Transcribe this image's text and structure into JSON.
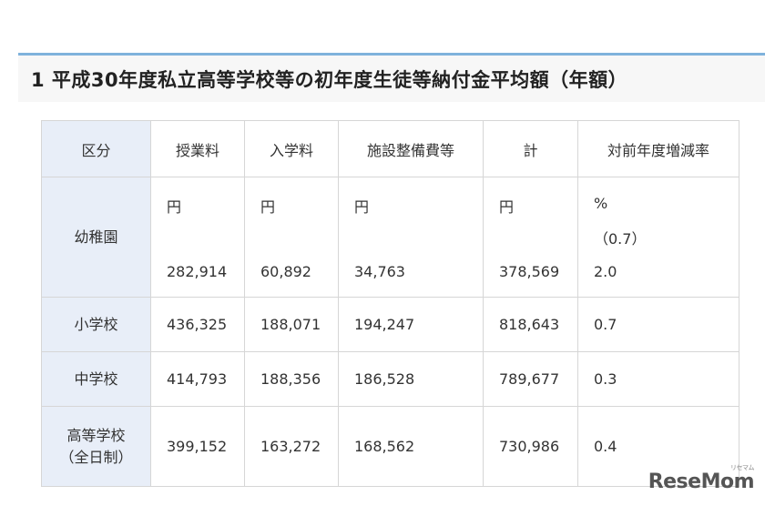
{
  "heading": "1 平成30年度私立高等学校等の初年度生徒等納付金平均額（年額）",
  "table": {
    "headers": [
      "区分",
      "授業料",
      "入学料",
      "施設整備費等",
      "計",
      "対前年度増減率"
    ],
    "kindergarten": {
      "label": "幼稚園",
      "unit_yen": "円",
      "unit_pct": "%",
      "prev_rate": "（0.7）",
      "tuition": "282,914",
      "admission": "60,892",
      "facility": "34,763",
      "total": "378,569",
      "rate": "2.0"
    },
    "elementary": {
      "label": "小学校",
      "tuition": "436,325",
      "admission": "188,071",
      "facility": "194,247",
      "total": "818,643",
      "rate": "0.7"
    },
    "junior": {
      "label": "中学校",
      "tuition": "414,793",
      "admission": "188,356",
      "facility": "186,528",
      "total": "789,677",
      "rate": "0.3"
    },
    "high": {
      "label_line1": "高等学校",
      "label_line2": "（全日制）",
      "tuition": "399,152",
      "admission": "163,272",
      "facility": "168,562",
      "total": "730,986",
      "rate": "0.4"
    }
  },
  "logo": {
    "text": "ReseMom",
    "kana": "リセマム"
  }
}
